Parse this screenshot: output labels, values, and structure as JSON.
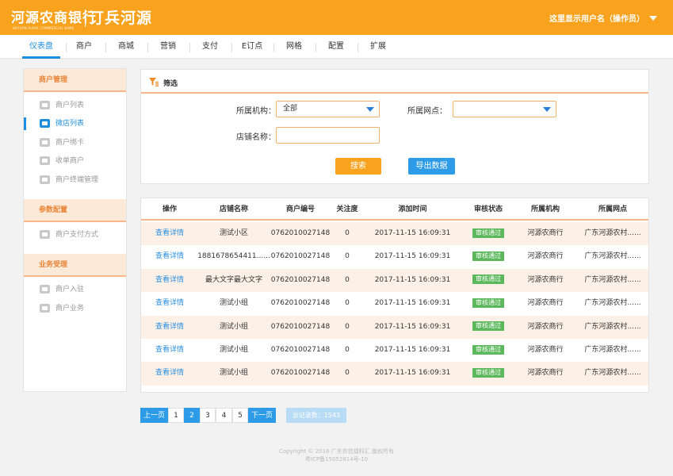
{
  "header": {
    "logo_text": "河源农商银行",
    "logo_sub": "HEYUAN RURAL COMMERCIAL BANK",
    "app_name": "订兵河源",
    "user_label": "这里显示用户名（操作员）"
  },
  "nav": {
    "items": [
      {
        "label": "仪表盘",
        "active": true
      },
      {
        "label": "商户"
      },
      {
        "label": "商城"
      },
      {
        "label": "营销"
      },
      {
        "label": "支付"
      },
      {
        "label": "E订点"
      },
      {
        "label": "网格"
      },
      {
        "label": "配置"
      },
      {
        "label": "扩展"
      }
    ]
  },
  "sidebar": {
    "sections": [
      {
        "title": "商户管理",
        "items": [
          "商户列表",
          "微店列表",
          "商户绑卡",
          "收单商户",
          "商户终端管理"
        ]
      },
      {
        "title": "参数配置",
        "items": [
          "商户支付方式"
        ]
      },
      {
        "title": "业务受理",
        "items": [
          "商户入驻",
          "商户业务"
        ]
      }
    ],
    "active_item": "微店列表"
  },
  "filter": {
    "title": "筛选",
    "org_label": "所属机构：",
    "org_value": "全部",
    "branch_label": "所属网点：",
    "branch_value": "",
    "shop_label": "店铺名称：",
    "shop_value": "",
    "search_btn": "搜索",
    "export_btn": "导出数据"
  },
  "table": {
    "headers": [
      "操作",
      "店铺名称",
      "商户编号",
      "关注度",
      "添加时间",
      "审核状态",
      "所属机构",
      "所属网点"
    ],
    "rows": [
      [
        "查看详情",
        "测试小区",
        "0762010027148",
        "0",
        "2017-11-15 16:09:31",
        "审核通过",
        "河源农商行",
        "广东河源农村......"
      ],
      [
        "查看详情",
        "1881678654411......",
        "0762010027148",
        "0",
        "2017-11-15 16:09:31",
        "审核通过",
        "河源农商行",
        "广东河源农村......"
      ],
      [
        "查看详情",
        "最大文字最大文字",
        "0762010027148",
        "0",
        "2017-11-15 16:09:31",
        "审核通过",
        "河源农商行",
        "广东河源农村......"
      ],
      [
        "查看详情",
        "测试小组",
        "0762010027148",
        "0",
        "2017-11-15 16:09:31",
        "审核通过",
        "河源农商行",
        "广东河源农村......"
      ],
      [
        "查看详情",
        "测试小组",
        "0762010027148",
        "0",
        "2017-11-15 16:09:31",
        "审核通过",
        "河源农商行",
        "广东河源农村......"
      ],
      [
        "查看详情",
        "测试小组",
        "0762010027148",
        "0",
        "2017-11-15 16:09:31",
        "审核通过",
        "河源农商行",
        "广东河源农村......"
      ],
      [
        "查看详情",
        "测试小组",
        "0762010027148",
        "0",
        "2017-11-15 16:09:31",
        "审核通过",
        "河源农商行",
        "广东河源农村......"
      ]
    ]
  },
  "pager": {
    "prev": "上一页",
    "pages": [
      "1",
      "2",
      "3",
      "4",
      "5"
    ],
    "current": "2",
    "next": "下一页",
    "total": "总记录数：1543"
  },
  "footer": {
    "line1": "Copyright © 2016 广东农信捷科汇 版权所有",
    "line2": "粤ICP备15052814号-10"
  },
  "colors": {
    "brand": "#f8a21d",
    "accent": "#1e8fdf",
    "success": "#5cb85c"
  }
}
